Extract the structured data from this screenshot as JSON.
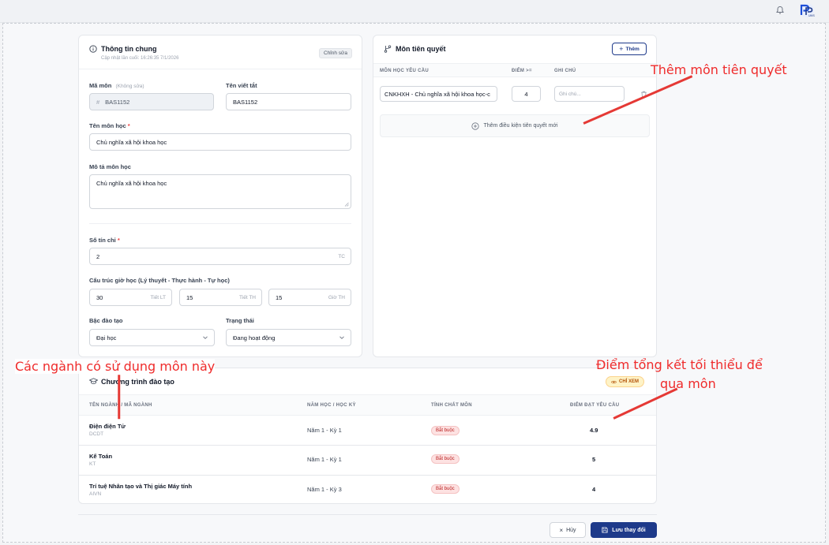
{
  "general": {
    "title": "Thông tin chung",
    "updated": "Cập nhật lần cuối: 16:26:35 7/1/2026",
    "edit_label": "Chỉnh sửa",
    "code_label": "Mã môn",
    "code_note": "(Không sửa)",
    "code_value": "BAS1152",
    "short_label": "Tên viết tắt",
    "short_value": "BAS1152",
    "name_label": "Tên môn học",
    "name_value": "Chủ nghĩa xã hội khoa học",
    "desc_label": "Mô tả môn học",
    "desc_value": "Chủ nghĩa xã hội khoa học",
    "credits_label": "Số tín chỉ",
    "credits_value": "2",
    "credits_unit": "TC",
    "hours_label": "Cấu trúc giờ học (Lý thuyết - Thực hành - Tự học)",
    "hours": [
      {
        "value": "30",
        "unit": "Tiết LT"
      },
      {
        "value": "15",
        "unit": "Tiết TH"
      },
      {
        "value": "15",
        "unit": "Giờ TH"
      }
    ],
    "level_label": "Bậc đào tạo",
    "level_value": "Đại học",
    "status_label": "Trạng thái",
    "status_value": "Đang hoạt động",
    "required_mark": "*"
  },
  "prereq": {
    "title": "Môn tiên quyết",
    "add_label": "Thêm",
    "col_subject": "MÔN HỌC YÊU CẦU",
    "col_score": "ĐIỂM >=",
    "col_note": "GHI CHÚ",
    "row_subject": "CNKHXH - Chủ nghĩa xã hội khoa học-c",
    "row_score": "4",
    "row_note_placeholder": "Ghi chú...",
    "add_condition": "Thêm điều kiện tiên quyết mới"
  },
  "programs": {
    "title": "Chương trình đào tạo",
    "badge": "CHỈ XEM",
    "headers": [
      "TÊN NGÀNH / MÃ NGÀNH",
      "NĂM HỌC / HỌC KỲ",
      "TÍNH CHẤT MÔN",
      "ĐIỂM ĐẠT YÊU CẦU"
    ],
    "rows": [
      {
        "name": "Điện điện Tử",
        "code": "DCDT",
        "term": "Năm 1 - Kỳ 1",
        "type": "Bắt buộc",
        "score": "4.9"
      },
      {
        "name": "Kế Toán",
        "code": "KT",
        "term": "Năm 1 - Kỳ 1",
        "type": "Bắt buộc",
        "score": "5"
      },
      {
        "name": "Trí tuệ Nhân tạo và Thị giác Máy tính",
        "code": "AIVN",
        "term": "Năm 1 - Kỳ 3",
        "type": "Bắt buộc",
        "score": "4"
      }
    ]
  },
  "footer": {
    "cancel_label": "Hủy",
    "save_label": "Lưu thay đổi"
  },
  "annotations": {
    "prereq": "Thêm môn tiên quyết",
    "programs": "Các ngành có sử dụng môn này",
    "score_line1": "Điểm tổng kết tối thiểu để",
    "score_line2": "qua môn"
  },
  "colors": {
    "primary": "#1e3a8a",
    "annotation": "#ef2b2b",
    "badge_red": "#fde2e2",
    "badge_orange": "#fef3c7"
  }
}
